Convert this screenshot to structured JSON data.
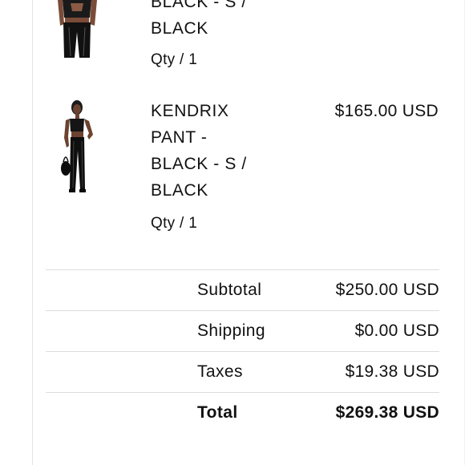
{
  "items": [
    {
      "title_lines": [
        "BLACK - S /",
        "BLACK"
      ],
      "qty": "Qty / 1",
      "price": ""
    },
    {
      "title_lines": [
        "KENDRIX",
        "PANT -",
        "BLACK - S /",
        "BLACK"
      ],
      "qty": "Qty / 1",
      "price": "$165.00 USD"
    }
  ],
  "summary": {
    "subtotal_label": "Subtotal",
    "subtotal_value": "$250.00 USD",
    "shipping_label": "Shipping",
    "shipping_value": "$0.00 USD",
    "taxes_label": "Taxes",
    "taxes_value": "$19.38 USD",
    "total_label": "Total",
    "total_value": "$269.38 USD"
  }
}
